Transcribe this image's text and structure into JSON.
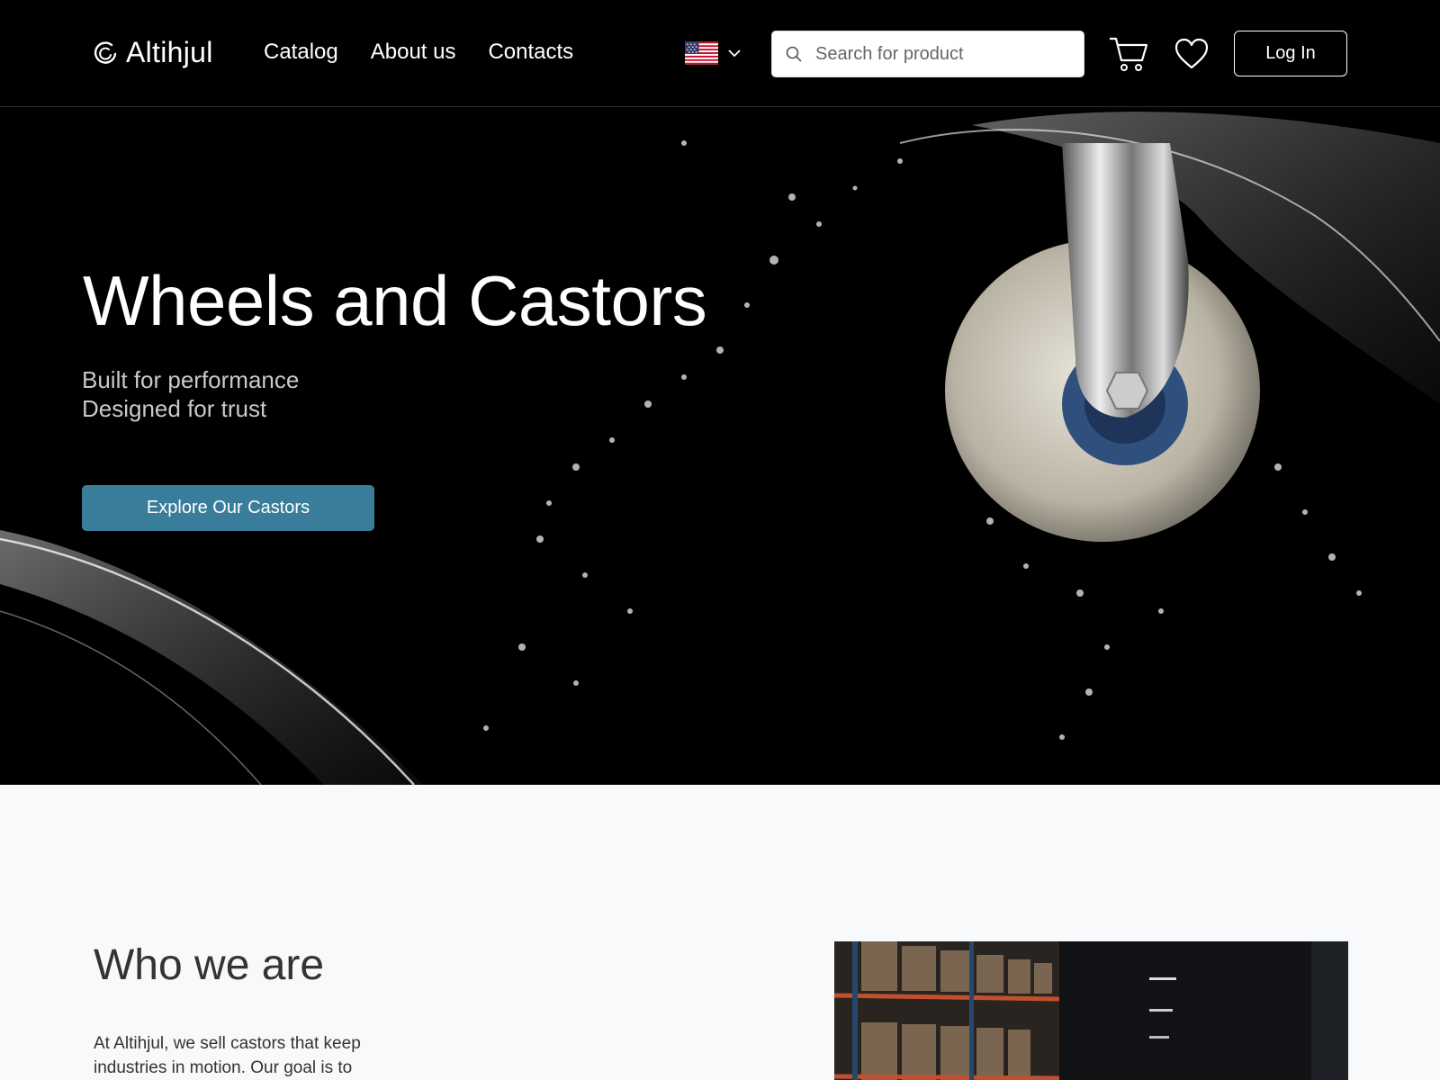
{
  "header": {
    "brand": "Altihjul",
    "nav": [
      {
        "label": "Catalog"
      },
      {
        "label": "About us"
      },
      {
        "label": "Contacts"
      }
    ],
    "language_icon": "us-flag-icon",
    "search": {
      "placeholder": "Search for product"
    },
    "cart_icon": "cart-icon",
    "wishlist_icon": "heart-icon",
    "login_label": "Log In"
  },
  "hero": {
    "title": "Wheels and Castors",
    "subtitle_line1": "Built for performance",
    "subtitle_line2": "Designed for trust",
    "cta_label": "Explore Our Castors"
  },
  "about": {
    "title": "Who we are",
    "text": "At Altihjul, we sell castors that keep industries in motion. Our goal is to"
  },
  "colors": {
    "accent": "#3a7d9a",
    "header_bg": "#000000",
    "page_bg": "#f8f9fb"
  }
}
